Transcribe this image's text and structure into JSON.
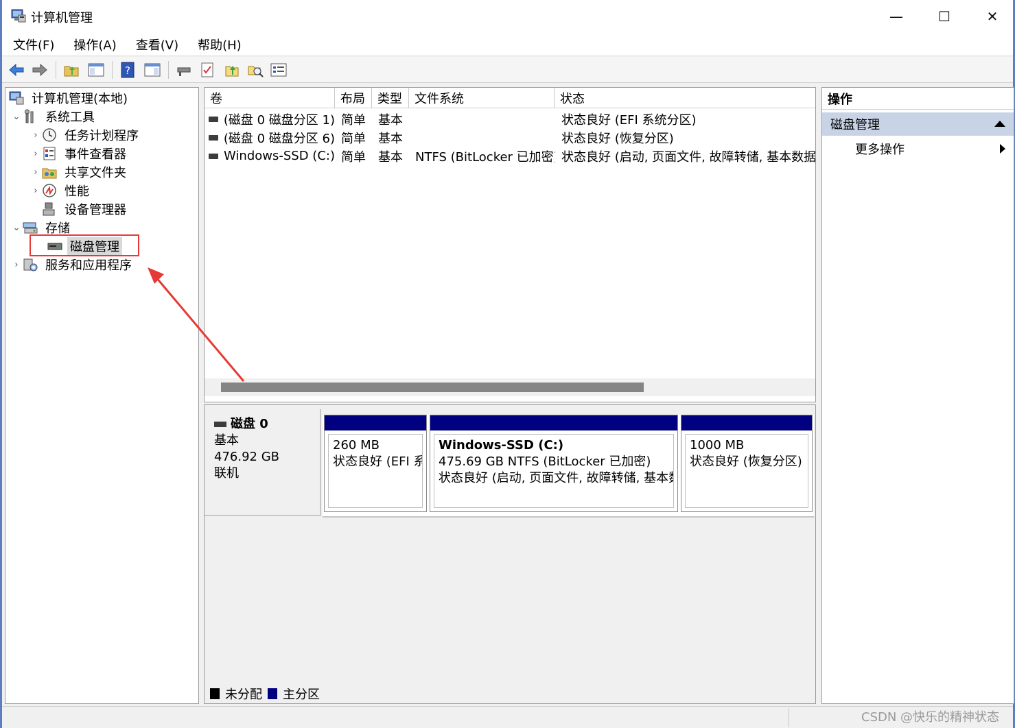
{
  "window": {
    "title": "计算机管理",
    "min_glyph": "—",
    "max_glyph": "☐",
    "close_glyph": "✕"
  },
  "menu": [
    "文件(F)",
    "操作(A)",
    "查看(V)",
    "帮助(H)"
  ],
  "tree": {
    "root": "计算机管理(本地)",
    "system_tools": "系统工具",
    "task_scheduler": "任务计划程序",
    "event_viewer": "事件查看器",
    "shared_folders": "共享文件夹",
    "performance": "性能",
    "device_manager": "设备管理器",
    "storage": "存储",
    "disk_management": "磁盘管理",
    "services_apps": "服务和应用程序"
  },
  "volume_list": {
    "columns": [
      "卷",
      "布局",
      "类型",
      "文件系统",
      "状态"
    ],
    "rows": [
      {
        "volume": "(磁盘 0 磁盘分区 1)",
        "layout": "简单",
        "type": "基本",
        "fs": "",
        "status": "状态良好 (EFI 系统分区)"
      },
      {
        "volume": "(磁盘 0 磁盘分区 6)",
        "layout": "简单",
        "type": "基本",
        "fs": "",
        "status": "状态良好 (恢复分区)"
      },
      {
        "volume": "Windows-SSD (C:)",
        "layout": "简单",
        "type": "基本",
        "fs": "NTFS (BitLocker 已加密)",
        "status": "状态良好 (启动, 页面文件, 故障转储, 基本数据分区)"
      }
    ]
  },
  "disk": {
    "name": "磁盘 0",
    "type": "基本",
    "size": "476.92 GB",
    "state": "联机",
    "partitions": [
      {
        "name": "",
        "size": "260 MB",
        "status": "状态良好 (EFI 系统分区)"
      },
      {
        "name": "Windows-SSD  (C:)",
        "size": "475.69 GB NTFS (BitLocker 已加密)",
        "status": "状态良好 (启动, 页面文件, 故障转储, 基本数据分区)"
      },
      {
        "name": "",
        "size": "1000 MB",
        "status": "状态良好 (恢复分区)"
      }
    ]
  },
  "legend": {
    "unallocated": "未分配",
    "primary": "主分区"
  },
  "actions": {
    "header": "操作",
    "section": "磁盘管理",
    "more": "更多操作"
  },
  "watermark": "CSDN @快乐的精神状态",
  "colors": {
    "partition_bar": "#000080",
    "highlight": "#e53935",
    "selection_section": "#c8d4e6"
  }
}
